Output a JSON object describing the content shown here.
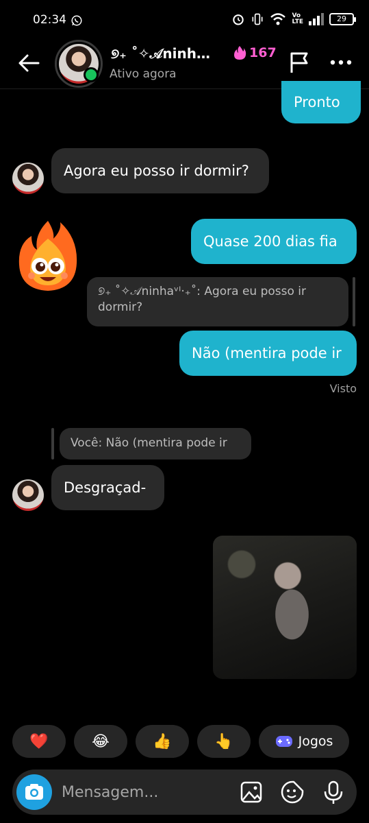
{
  "status_bar": {
    "time": "02:34",
    "battery": "29",
    "volte": "Vo\nLTE"
  },
  "header": {
    "contact_name": "୭₊ ˚✧𝒜ninh…",
    "streak_count": "167",
    "status": "Ativo agora"
  },
  "messages": {
    "m1": "Pronto",
    "m2": "Agora eu posso ir dormir?",
    "m3": "Quase 200 dias fia",
    "m3_reply_quote": "୭₊ ˚✧𝒜ninhaᵛᴵ·₊˚: Agora eu posso ir dormir?",
    "m4": "Não (mentira pode ir",
    "seen": "Visto",
    "m5_reply_quote": "Você: Não (mentira pode ir",
    "m5": "Desgraçad-"
  },
  "quick_replies": {
    "heart": "❤️",
    "laugh": "😂",
    "thumbs_up": "👍",
    "point": "👆",
    "games_label": "Jogos"
  },
  "composer": {
    "placeholder": "Mensagem..."
  },
  "colors": {
    "sent_bubble": "#1fb3cd",
    "received_bubble": "#2a2a2a",
    "online": "#18c35c",
    "streak": "#ff5fd2"
  }
}
